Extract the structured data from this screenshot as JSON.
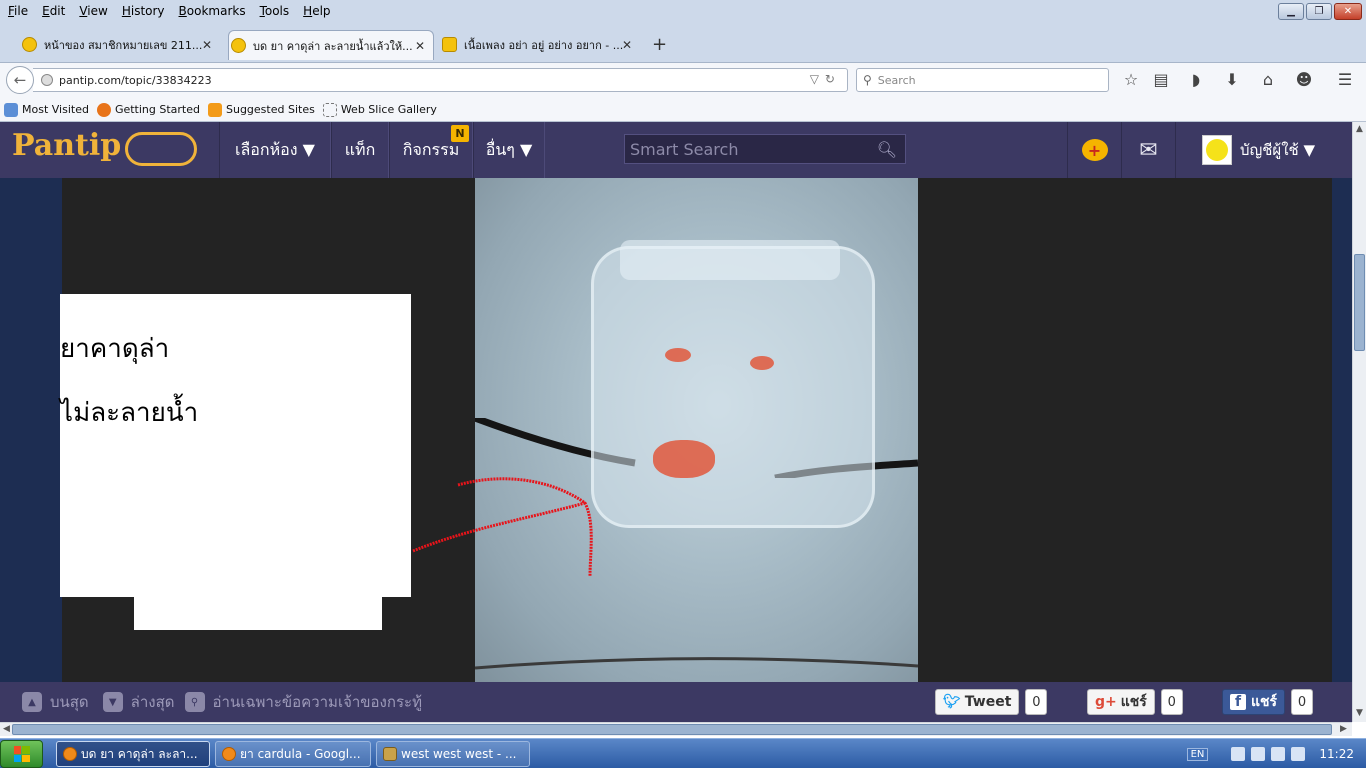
{
  "menubar": {
    "items": [
      "File",
      "Edit",
      "View",
      "History",
      "Bookmarks",
      "Tools",
      "Help"
    ]
  },
  "tabs": [
    {
      "label": "หน้าของ สมาชิกหมายเลข 211..."
    },
    {
      "label": "บด ยา คาดุล่า ละลายน้ำแล้วให้..."
    },
    {
      "label": "เนื้อเพลง อย่า อยู่ อย่าง อยาก - ..."
    }
  ],
  "navbar": {
    "url": "pantip.com/topic/33834223",
    "search_placeholder": "Search"
  },
  "bookmarks": [
    {
      "label": "Most Visited"
    },
    {
      "label": "Getting Started"
    },
    {
      "label": "Suggested Sites"
    },
    {
      "label": "Web Slice Gallery"
    }
  ],
  "pantip": {
    "logo": "Pantip",
    "nav": [
      "เลือกห้อง ▼",
      "แท็ก",
      "กิจกรรม",
      "อื่นๆ ▼"
    ],
    "badge": "N",
    "smart_search_placeholder": "Smart Search",
    "account_label": "บัญชีผู้ใช้ ▼"
  },
  "post": {
    "line1": "ยาคาดุล่า",
    "line2": "ไม่ละลายน้ำ"
  },
  "bottom_bar": {
    "top": "บนสุด",
    "bottom": "ล่างสุด",
    "owner_only": "อ่านเฉพาะข้อความเจ้าของกระทู้",
    "tweet_label": "Tweet",
    "tweet_count": "0",
    "gplus_label": "แชร์",
    "gplus_count": "0",
    "fb_label": "แชร์",
    "fb_count": "0"
  },
  "taskbar": {
    "tasks": [
      {
        "label": "บด ยา คาดุล่า ละลา..."
      },
      {
        "label": "ยา cardula - Googl..."
      },
      {
        "label": "west  west west - ..."
      }
    ],
    "lang": "EN",
    "clock": "11:22"
  },
  "colors": {
    "pantip_header": "#3c3963",
    "logo_gold": "#f0b33a",
    "rail_blue": "#1d2d52",
    "annotation_red": "#e8141a"
  }
}
